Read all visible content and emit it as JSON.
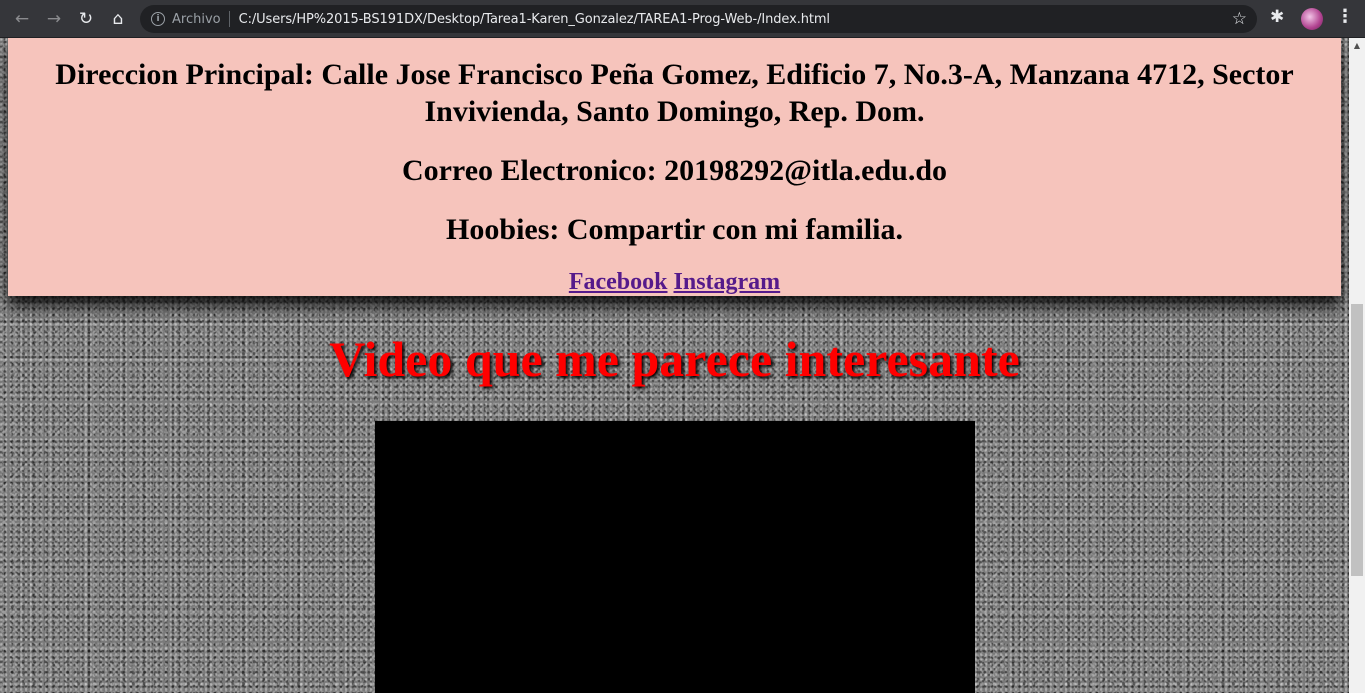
{
  "browser": {
    "back_icon": "←",
    "forward_icon": "→",
    "reload_icon": "↻",
    "home_icon": "⌂",
    "info_icon": "i",
    "origin_label": "Archivo",
    "url": "C:/Users/HP%2015-BS191DX/Desktop/Tarea1-Karen_Gonzalez/TAREA1-Prog-Web-/Index.html",
    "bookmark_icon": "☆",
    "extensions_icon": "✱",
    "menu_icon": "⋮"
  },
  "info_card": {
    "address": "Direccion Principal: Calle Jose Francisco Peña Gomez, Edificio 7, No.3-A, Manzana 4712, Sector Invivienda, Santo Domingo, Rep. Dom.",
    "email": "Correo Electronico: 20198292@itla.edu.do",
    "hobbies": "Hoobies: Compartir con mi familia.",
    "links": {
      "facebook": "Facebook",
      "instagram": "Instagram"
    }
  },
  "video_section": {
    "heading": "Video que me parece interesante"
  },
  "scrollbar": {
    "up_arrow": "▲"
  },
  "colors": {
    "card_background": "#f6c4bc",
    "heading_red": "#ff0000",
    "link_visited": "#551a8b",
    "chrome_toolbar": "#35363a"
  }
}
